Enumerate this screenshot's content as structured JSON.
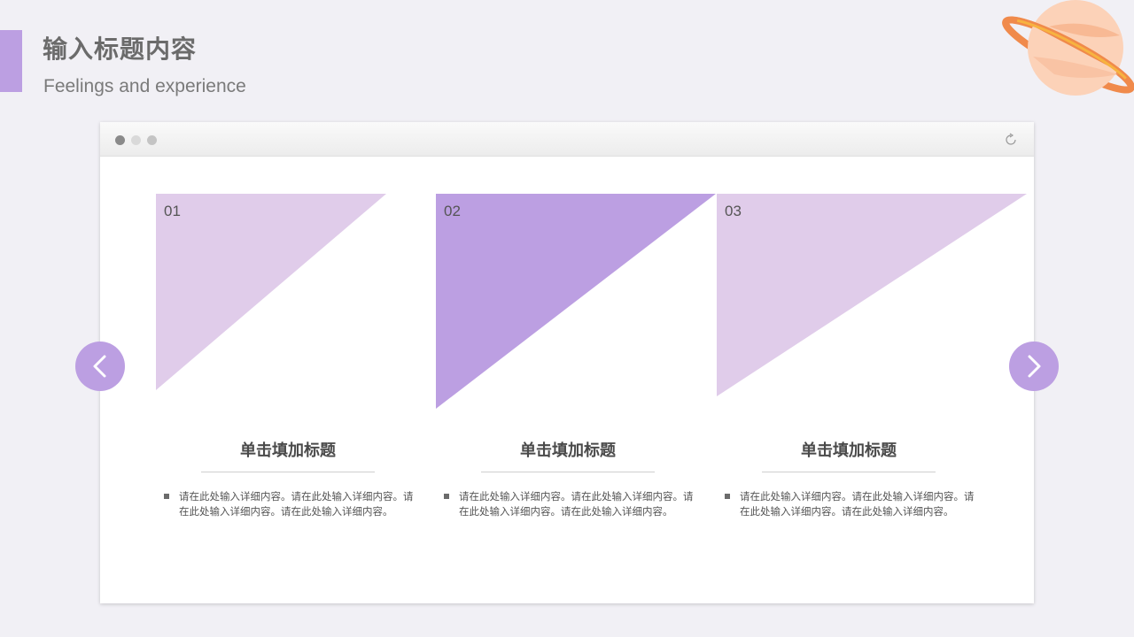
{
  "header": {
    "title": "输入标题内容",
    "subtitle": "Feelings and experience"
  },
  "window": {
    "controls": [
      "close-dot",
      "minimize-dot",
      "maximize-dot"
    ],
    "reload_icon": "reload-icon"
  },
  "cards": [
    {
      "number": "01",
      "title": "单击填加标题",
      "description": "请在此处输入详细内容。请在此处输入详细内容。请在此处输入详细内容。请在此处输入详细内容。",
      "color": "#e0ccea"
    },
    {
      "number": "02",
      "title": "单击填加标题",
      "description": "请在此处输入详细内容。请在此处输入详细内容。请在此处输入详细内容。请在此处输入详细内容。",
      "color": "#bc9fe2"
    },
    {
      "number": "03",
      "title": "单击填加标题",
      "description": "请在此处输入详细内容。请在此处输入详细内容。请在此处输入详细内容。请在此处输入详细内容。",
      "color": "#e0ccea"
    }
  ],
  "navigation": {
    "prev_icon": "chevron-left-icon",
    "next_icon": "chevron-right-icon"
  },
  "decoration": {
    "planet_icon": "planet-icon"
  },
  "colors": {
    "accent": "#bc9fe2",
    "accent_light": "#e0ccea",
    "background": "#f1f0f5"
  }
}
